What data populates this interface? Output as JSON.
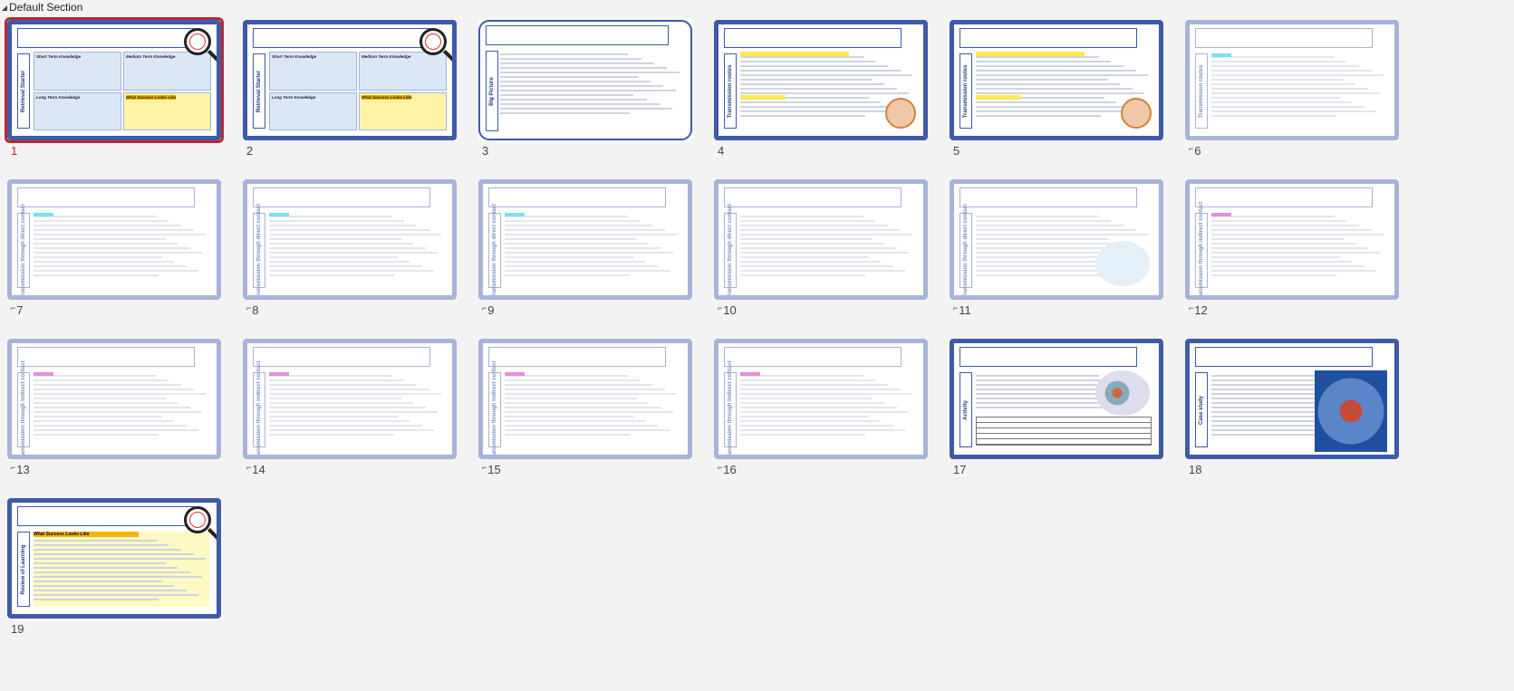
{
  "section": {
    "title": "Default Section",
    "collapse_icon": "triangle-down-icon"
  },
  "thumbnails": [
    {
      "number": "1",
      "star": false,
      "selected": true,
      "style": "four-box",
      "side": "Retrieval Starter",
      "boxes": [
        "Short Term Knowledge",
        "Medium Term Knowledge",
        "Long Term Knowledge",
        "What Success Looks Like"
      ],
      "image": "magnifier"
    },
    {
      "number": "2",
      "star": false,
      "selected": false,
      "style": "four-box",
      "side": "Retrieval Starter",
      "boxes": [
        "Short Term Knowledge",
        "Medium Term Knowledge",
        "Long Term Knowledge",
        "What Success Looks Like"
      ],
      "image": "magnifier"
    },
    {
      "number": "3",
      "star": false,
      "selected": false,
      "style": "bigpicture",
      "side": "Big Picture"
    },
    {
      "number": "4",
      "star": false,
      "selected": false,
      "style": "text-yellow",
      "side": "Transmission routes",
      "image": "hand"
    },
    {
      "number": "5",
      "star": false,
      "selected": false,
      "style": "text-yellow",
      "side": "Transmission routes",
      "image": "hand"
    },
    {
      "number": "6",
      "star": true,
      "selected": false,
      "style": "faded-cyan",
      "side": "Transmission routes"
    },
    {
      "number": "7",
      "star": true,
      "selected": false,
      "style": "faded-cyan",
      "side": "Transmission through direct contact"
    },
    {
      "number": "8",
      "star": true,
      "selected": false,
      "style": "faded-cyan",
      "side": "Transmission through direct contact"
    },
    {
      "number": "9",
      "star": true,
      "selected": false,
      "style": "faded-cyan",
      "side": "Transmission through direct contact"
    },
    {
      "number": "10",
      "star": true,
      "selected": false,
      "style": "faded-plain",
      "side": "Transmission through direct contact"
    },
    {
      "number": "11",
      "star": true,
      "selected": false,
      "style": "faded-books",
      "side": "Transmission through direct contact"
    },
    {
      "number": "12",
      "star": true,
      "selected": false,
      "style": "faded-pink",
      "side": "Transmission through indirect contact"
    },
    {
      "number": "13",
      "star": true,
      "selected": false,
      "style": "faded-pink",
      "side": "Transmission through indirect contact"
    },
    {
      "number": "14",
      "star": true,
      "selected": false,
      "style": "faded-pink",
      "side": "Transmission through indirect contact"
    },
    {
      "number": "15",
      "star": true,
      "selected": false,
      "style": "faded-pink",
      "side": "Transmission through indirect contact"
    },
    {
      "number": "16",
      "star": true,
      "selected": false,
      "style": "faded-pink",
      "side": "Transmission through indirect contact"
    },
    {
      "number": "17",
      "star": false,
      "selected": false,
      "style": "activity",
      "side": "Activity",
      "image": "cells"
    },
    {
      "number": "18",
      "star": false,
      "selected": false,
      "style": "casestudy",
      "side": "Case study",
      "image": "heart"
    },
    {
      "number": "19",
      "star": false,
      "selected": false,
      "style": "review",
      "side": "Review of Learning",
      "boxes": [
        "What Success Looks Like"
      ],
      "image": "magnifier"
    }
  ]
}
